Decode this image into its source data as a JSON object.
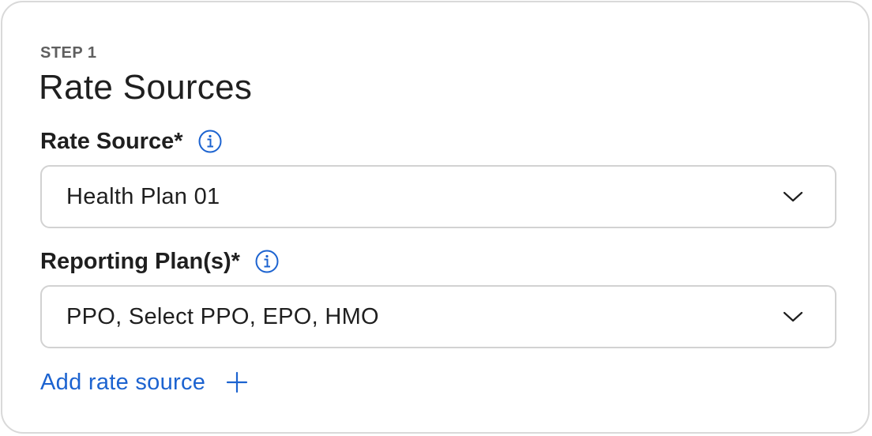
{
  "step": {
    "label": "STEP 1",
    "title": "Rate Sources"
  },
  "rate_source": {
    "label": "Rate Source*",
    "info_icon": "info-icon",
    "selected_value": "Health Plan 01",
    "chevron_icon": "chevron-down-icon"
  },
  "reporting_plans": {
    "label": "Reporting Plan(s)*",
    "info_icon": "info-icon",
    "selected_value": "PPO, Select PPO, EPO, HMO",
    "chevron_icon": "chevron-down-icon"
  },
  "add_rate_source": {
    "label": "Add rate source",
    "icon": "plus-icon"
  },
  "colors": {
    "accent": "#1c63d0",
    "text": "#1f1f1f",
    "muted": "#5f5f5f",
    "border": "#d2d2d2"
  }
}
